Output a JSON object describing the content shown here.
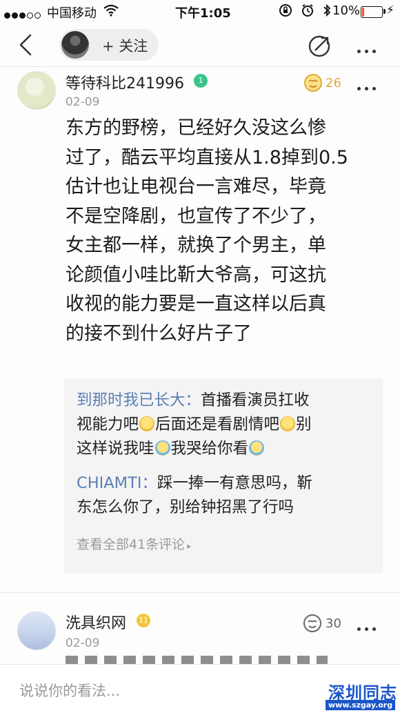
{
  "status_bar": {
    "carrier": "中国移动",
    "time": "下午1:05",
    "battery": "10%",
    "battery_level": 0.1
  },
  "nav": {
    "follow_label": "+ 关注"
  },
  "comments": [
    {
      "username": "等待科比241996",
      "date": "02-09",
      "likes": "26",
      "like_color": "#e0a93a",
      "badge_color": "#3cc48a",
      "content_lines": [
        "东方的野榜，已经好久没这么惨",
        "过了，酷云平均直接从1.8掉到0.5",
        "估计也让电视台一言难尽，毕竟",
        "不是空降剧，也宣传了不少了，",
        "女主都一样，就换了个男主，单",
        "论颜值小哇比靳大爷高，可这抗",
        "收视的能力要是一直这样以后真",
        "的接不到什么好片子了"
      ],
      "replies": [
        {
          "name": "到那时我已长大：",
          "lines": [
            "首播看演员扛收",
            "视能力吧",
            "后面还是看剧情吧",
            "别",
            "这样说我哇",
            "我哭给你看"
          ]
        },
        {
          "name": "CHIAMTI：",
          "lines": [
            "踩一捧一有意思吗，靳",
            "东怎么你了，别给钟招黑了行吗"
          ]
        }
      ],
      "view_all": "查看全部41条评论"
    },
    {
      "username": "洗具织网",
      "date": "02-09",
      "likes": "30",
      "like_color": "#666666",
      "badge_color": "#f2c53d"
    }
  ],
  "input": {
    "placeholder": "说说你的看法..."
  },
  "watermark": {
    "title": "深圳同志",
    "url": "www.szgay.org"
  }
}
